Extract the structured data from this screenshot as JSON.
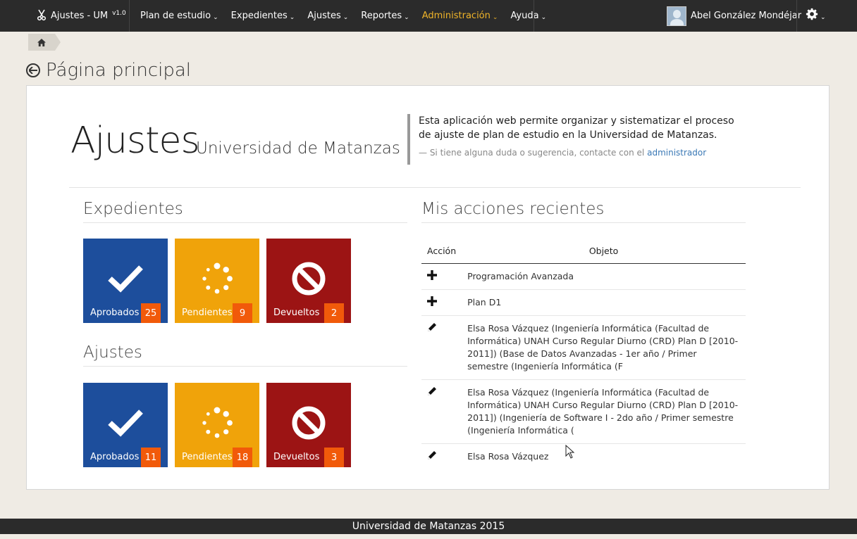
{
  "nav": {
    "brand": "Ajustes - UM",
    "version": "v1.0",
    "menu": [
      {
        "label": "Plan de estudio",
        "active": false
      },
      {
        "label": "Expedientes",
        "active": false
      },
      {
        "label": "Ajustes",
        "active": false
      },
      {
        "label": "Reportes",
        "active": false
      },
      {
        "label": "Administración",
        "active": true
      },
      {
        "label": "Ayuda",
        "active": false
      }
    ],
    "user_name": "Abel González Mondéjar",
    "active_color": "#f0b429"
  },
  "page": {
    "title": "Página principal"
  },
  "hero": {
    "title": "Ajustes",
    "subtitle": "Universidad de Matanzas",
    "description": "Esta aplicación web permite organizar y sistematizar el proceso de ajuste de plan de estudio en la Universidad de Matanzas.",
    "contact_prefix": "— Si tiene alguna duda o sugerencia, contacte con el",
    "contact_link": "administrador"
  },
  "expedientes": {
    "title": "Expedientes",
    "tiles": [
      {
        "label": "Aprobados",
        "count": "25",
        "icon": "check-icon",
        "color": "#1d4e9c"
      },
      {
        "label": "Pendientes",
        "count": "9",
        "icon": "spinner-icon",
        "color": "#f0a30a"
      },
      {
        "label": "Devueltos",
        "count": "2",
        "icon": "ban-icon",
        "color": "#9c1414"
      }
    ]
  },
  "ajustes": {
    "title": "Ajustes",
    "tiles": [
      {
        "label": "Aprobados",
        "count": "11",
        "icon": "check-icon",
        "color": "#1d4e9c"
      },
      {
        "label": "Pendientes",
        "count": "18",
        "icon": "spinner-icon",
        "color": "#f0a30a"
      },
      {
        "label": "Devueltos",
        "count": "3",
        "icon": "ban-icon",
        "color": "#9c1414"
      }
    ]
  },
  "recent": {
    "title": "Mis acciones recientes",
    "col_action": "Acción",
    "col_object": "Objeto",
    "rows": [
      {
        "action_icon": "plus-icon",
        "object": "Programación Avanzada"
      },
      {
        "action_icon": "plus-icon",
        "object": "Plan D1"
      },
      {
        "action_icon": "pencil-icon",
        "object": "Elsa Rosa Vázquez (Ingeniería Informática (Facultad de Informática) UNAH Curso Regular Diurno (CRD) Plan D [2010-2011]) (Base de Datos Avanzadas - 1er año / Primer semestre (Ingeniería Informática (F"
      },
      {
        "action_icon": "pencil-icon",
        "object": "Elsa Rosa Vázquez (Ingeniería Informática (Facultad de Informática) UNAH Curso Regular Diurno (CRD) Plan D [2010-2011]) (Ingeniería de Software I - 2do año / Primer semestre (Ingeniería Informática ("
      },
      {
        "action_icon": "pencil-icon",
        "object": "Elsa Rosa Vázquez"
      }
    ]
  },
  "footer": {
    "text": "Universidad de Matanzas 2015"
  }
}
